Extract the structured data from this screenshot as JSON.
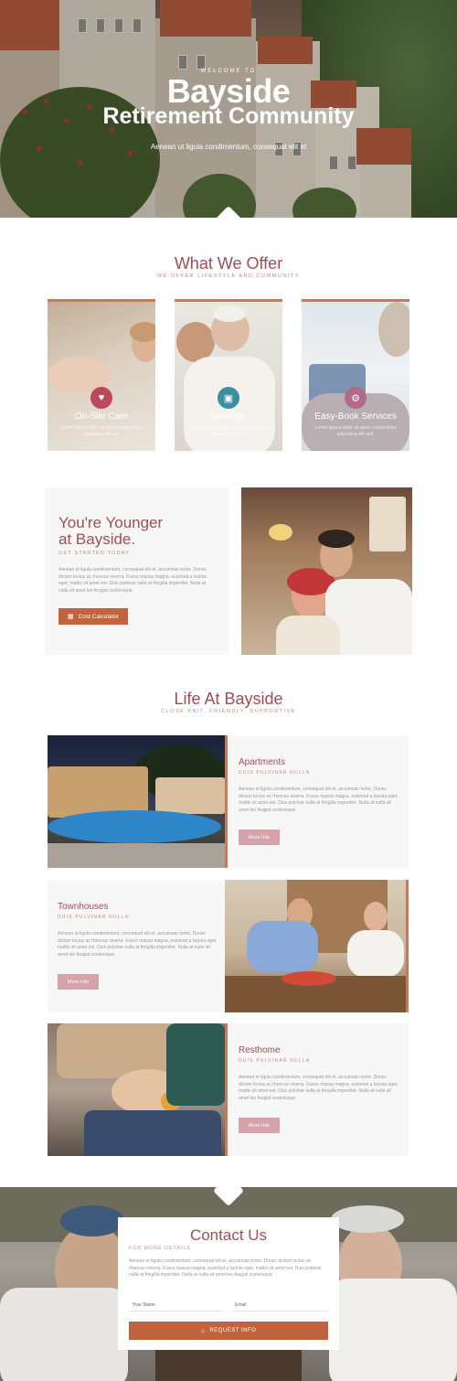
{
  "hero": {
    "welcome": "WELCOME TO",
    "title_line1": "Bayside",
    "title_line2": "Retirement Community",
    "subtitle": "Aenean ut ligula condimentum, consequat elit et"
  },
  "offer": {
    "title": "What We Offer",
    "subtitle": "WE OFFER LIFESTYLE AND COMMUNITY",
    "cards": [
      {
        "label": "On-Site Care",
        "icon": "heartbeat-icon",
        "icon_color": "#b94a5b",
        "desc": "Lorem ipsum dolor sit amet, consectetur adipiscing elit sed."
      },
      {
        "label": "Lifestyle",
        "icon": "id-card-icon",
        "icon_color": "#3a8fa0",
        "desc": "Lorem ipsum dolor sit amet, consectetur adipiscing elit sed."
      },
      {
        "label": "Easy-Book Services",
        "icon": "gear-icon",
        "icon_color": "#b36a8a",
        "desc": "Lorem ipsum dolor sit amet, consectetur adipiscing elit sed."
      }
    ]
  },
  "younger": {
    "title_line1": "You're Younger",
    "title_line2": "at Bayside.",
    "subtitle": "GET STARTED TODAY",
    "body": "Aenean et ligula condimentum, consequat elit et, accumsan tortor. Donec dictum lectus ac rhoncus viverra. Fusce massa magna, euismod a lacinia eget, mattis sit amet est. Duis pulvinar nulla at fringilla imperdiet. Nulla at nulla sit amet leo feugiat scelerisque.",
    "button": "Cost Calculator"
  },
  "life": {
    "title": "Life At Bayside",
    "subtitle": "CLOSE KNIT, FRIENDLY, SUPPORTIVE",
    "items": [
      {
        "title": "Apartments",
        "subtitle": "DUIS PULVINAR NULLA",
        "body": "Aenean et ligula condimentum, consequat elit et, accumsan tortor. Donec dictum lectus ac rhoncus viverra. Fusce massa magna, euismod a lacinia eget, mattis sit amet est. Duis pulvinar nulla at fringilla imperdiet. Nulla at nulla sit amet leo feugiat scelerisque.",
        "button": "More Info"
      },
      {
        "title": "Townhouses",
        "subtitle": "DUIS PULVINAR NULLA",
        "body": "Aenean et ligula condimentum, consequat elit et, accumsan tortor. Donec dictum lectus ac rhoncus viverra. Fusce massa magna, euismod a lacinia eget, mattis sit amet est. Duis pulvinar nulla at fringilla imperdiet. Nulla at nulla sit amet leo feugiat scelerisque.",
        "button": "More Info"
      },
      {
        "title": "Resthome",
        "subtitle": "DUIS PULVINAR NULLA",
        "body": "Aenean et ligula condimentum, consequat elit et, accumsan tortor. Donec dictum lectus ac rhoncus viverra. Fusce massa magna, euismod a lacinia eget, mattis sit amet est. Duis pulvinar nulla at fringilla imperdiet. Nulla at nulla sit amet leo feugiat scelerisque.",
        "button": "More Info"
      }
    ]
  },
  "contact": {
    "title": "Contact Us",
    "subtitle": "FOR MORE DETAILS",
    "body": "Aenean et ligula condimentum, consequat elit et, accumsan tortor. Donec dictum lectus ac rhoncus viverra. Fusce massa magna, euismod a lacinia eget, mattis sit amet est. Duis pulvinar nulla at fringilla imperdiet. Nulla at nulla sit amet leo feugiat scelerisque.",
    "name_placeholder": "Your Name",
    "email_placeholder": "Email",
    "button": "REQUEST INFO"
  },
  "colors": {
    "accent_rust": "#c0643f",
    "heading": "#a04d57",
    "subheading": "#c98880",
    "button_pink": "#d6a2ac"
  }
}
